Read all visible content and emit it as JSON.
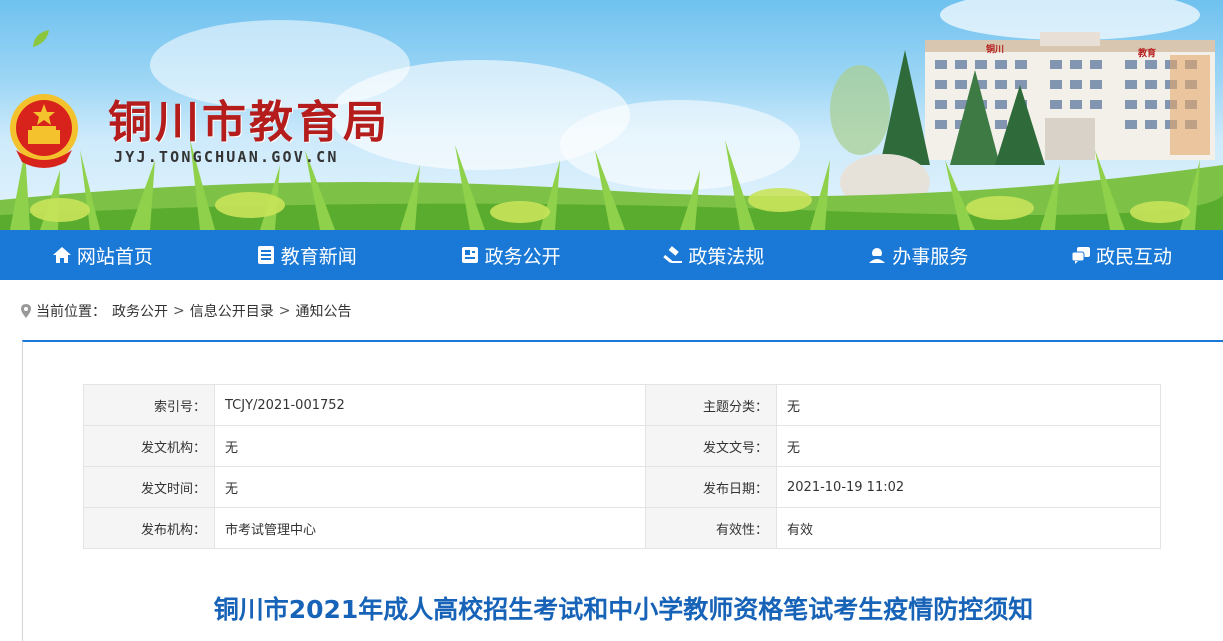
{
  "header": {
    "site_title": "铜川市教育局",
    "site_domain": "JYJ.TONGCHUAN.GOV.CN",
    "emblem_icon": "national-emblem-icon",
    "building_signs": [
      "铜川",
      "教育"
    ]
  },
  "nav": {
    "items": [
      {
        "label": "网站首页",
        "icon": "home-icon"
      },
      {
        "label": "教育新闻",
        "icon": "news-list-icon"
      },
      {
        "label": "政务公开",
        "icon": "document-icon"
      },
      {
        "label": "政策法规",
        "icon": "gavel-icon"
      },
      {
        "label": "办事服务",
        "icon": "service-icon"
      },
      {
        "label": "政民互动",
        "icon": "chat-icon"
      }
    ],
    "colors": {
      "background": "#1a79d6",
      "text": "#ffffff"
    }
  },
  "breadcrumb": {
    "prefix": "当前位置：",
    "items": [
      "政务公开",
      "信息公开目录",
      "通知公告"
    ],
    "separator": ">"
  },
  "meta_table": {
    "rows": [
      [
        {
          "key": "索引号：",
          "value": "TCJY/2021-001752"
        },
        {
          "key": "主题分类：",
          "value": "无"
        }
      ],
      [
        {
          "key": "发文机构：",
          "value": "无"
        },
        {
          "key": "发文文号：",
          "value": "无"
        }
      ],
      [
        {
          "key": "发文时间：",
          "value": "无"
        },
        {
          "key": "发布日期：",
          "value": "2021-10-19 11:02"
        }
      ],
      [
        {
          "key": "发布机构：",
          "value": "市考试管理中心"
        },
        {
          "key": "有效性：",
          "value": "有效"
        }
      ]
    ]
  },
  "article": {
    "title": "铜川市2021年成人高校招生考试和中小学教师资格笔试考生疫情防控须知",
    "title_color": "#1763b8"
  }
}
